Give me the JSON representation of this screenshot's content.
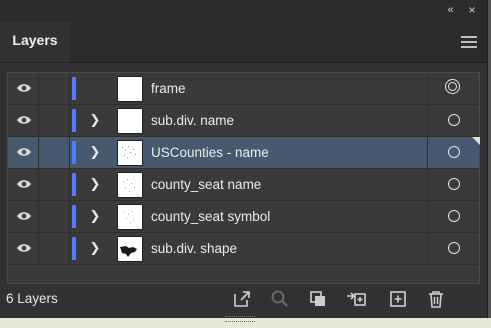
{
  "panel": {
    "collapse_glyph": "«",
    "close_glyph": "×",
    "tab_label": "Layers",
    "menu_icon": "hamburger-menu-icon"
  },
  "layers": [
    {
      "name": "frame",
      "expandable": false,
      "selected": false,
      "target": "double"
    },
    {
      "name": "sub.div. name",
      "expandable": true,
      "selected": false,
      "target": "single"
    },
    {
      "name": "USCounties - name",
      "expandable": true,
      "selected": true,
      "target": "single"
    },
    {
      "name": "county_seat name",
      "expandable": true,
      "selected": false,
      "target": "single"
    },
    {
      "name": "county_seat symbol",
      "expandable": true,
      "selected": false,
      "target": "single"
    },
    {
      "name": "sub.div. shape",
      "expandable": true,
      "selected": false,
      "target": "single"
    }
  ],
  "footer": {
    "count_label": "6 Layers",
    "icons": [
      "export-icon",
      "search-icon",
      "clipping-mask-icon",
      "move-to-layer-icon",
      "new-layer-icon",
      "trash-icon"
    ]
  },
  "colors": {
    "panel_bg": "#323232",
    "list_bg": "#3a3a3a",
    "selected_row": "#46596f",
    "layer_color": "#4f7cff"
  }
}
